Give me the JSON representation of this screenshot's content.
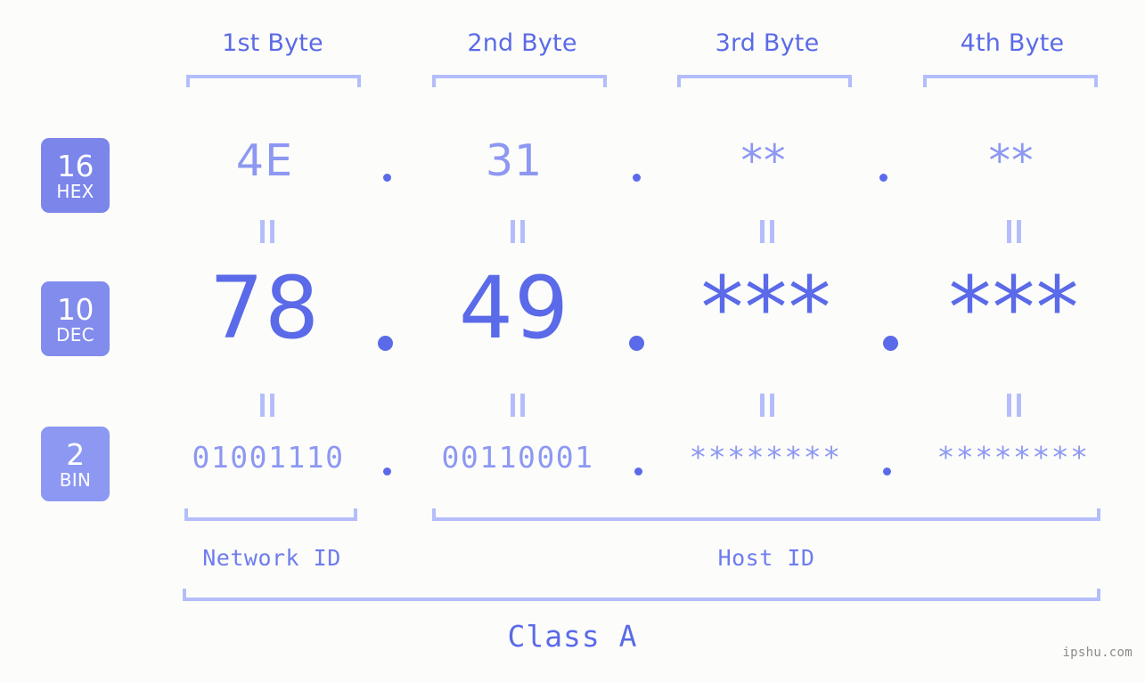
{
  "page": {
    "background_color": "#fcfdfa",
    "accent_color": "#5b6ae8",
    "accent_light_color": "#8d98f2",
    "bracket_color": "#b4bdfb",
    "watermark": "ipshu.com"
  },
  "byte_headers": [
    {
      "label": "1st Byte"
    },
    {
      "label": "2nd Byte"
    },
    {
      "label": "3rd Byte"
    },
    {
      "label": "4th Byte"
    }
  ],
  "radix_badges": [
    {
      "number": "16",
      "name": "HEX",
      "color": "#7b85ea"
    },
    {
      "number": "10",
      "name": "DEC",
      "color": "#828cec"
    },
    {
      "number": "2",
      "name": "BIN",
      "color": "#8d98f2"
    }
  ],
  "rows": {
    "hex": {
      "radix": "16",
      "radix_name": "HEX",
      "values": [
        "4E",
        "31",
        "**",
        "**"
      ],
      "separator": "."
    },
    "dec": {
      "radix": "10",
      "radix_name": "DEC",
      "values": [
        "78",
        "49",
        "***",
        "***"
      ],
      "separator": "."
    },
    "bin": {
      "radix": "2",
      "radix_name": "BIN",
      "values": [
        "01001110",
        "00110001",
        "********",
        "********"
      ],
      "separator": "."
    }
  },
  "equals_marker": "||",
  "id_sections": [
    {
      "label": "Network ID"
    },
    {
      "label": "Host ID"
    }
  ],
  "class_label": "Class A"
}
